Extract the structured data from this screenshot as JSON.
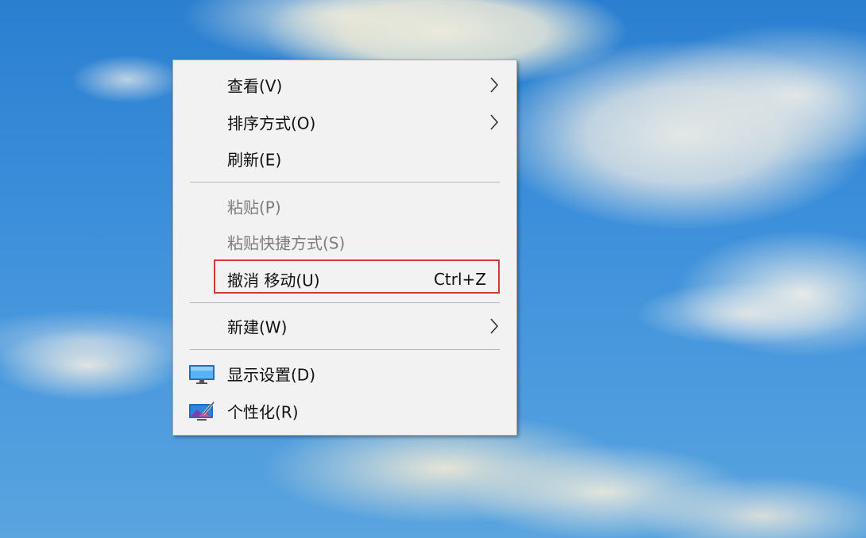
{
  "context_menu": {
    "items": [
      {
        "label": "查看(V)",
        "has_submenu": true,
        "enabled": true
      },
      {
        "label": "排序方式(O)",
        "has_submenu": true,
        "enabled": true
      },
      {
        "label": "刷新(E)",
        "has_submenu": false,
        "enabled": true
      },
      {
        "label": "粘贴(P)",
        "has_submenu": false,
        "enabled": false
      },
      {
        "label": "粘贴快捷方式(S)",
        "has_submenu": false,
        "enabled": false
      },
      {
        "label": "撤消 移动(U)",
        "shortcut": "Ctrl+Z",
        "has_submenu": false,
        "enabled": true,
        "highlighted": true
      },
      {
        "label": "新建(W)",
        "has_submenu": true,
        "enabled": true
      },
      {
        "label": "显示设置(D)",
        "icon": "display-settings-icon",
        "has_submenu": false,
        "enabled": true
      },
      {
        "label": "个性化(R)",
        "icon": "personalize-icon",
        "has_submenu": false,
        "enabled": true
      }
    ]
  },
  "colors": {
    "highlight_border": "#d23a3a",
    "menu_background": "#f2f2f2",
    "disabled_text": "#7d7d7d"
  }
}
